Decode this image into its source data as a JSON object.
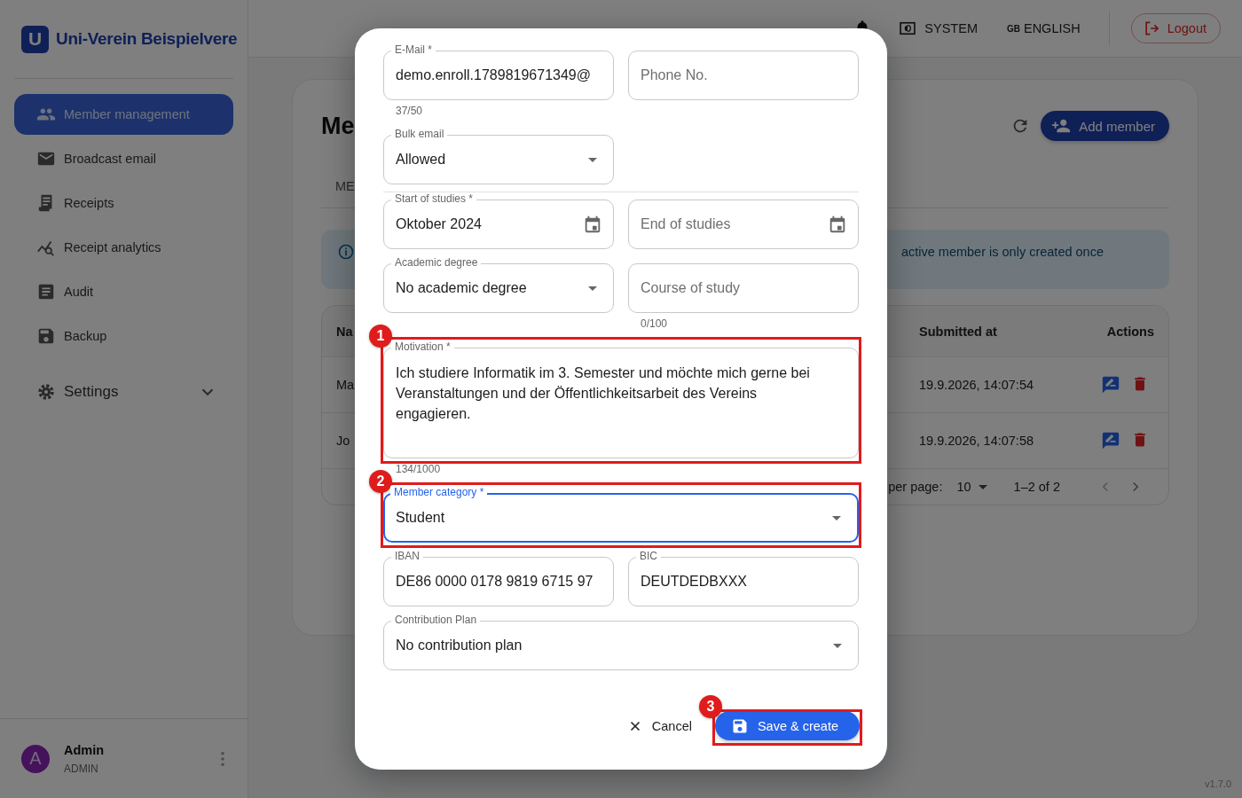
{
  "sidebar": {
    "brand": {
      "logo": "U",
      "name": "Uni-Verein Beispielvere"
    },
    "items": [
      {
        "kind": "link",
        "label": "Member management",
        "selected": true
      },
      {
        "kind": "link",
        "label": "Broadcast email",
        "selected": false
      },
      {
        "kind": "link",
        "label": "Receipts",
        "selected": false
      },
      {
        "kind": "link",
        "label": "Receipt analytics",
        "selected": false
      },
      {
        "kind": "link",
        "label": "Audit",
        "selected": false
      },
      {
        "kind": "link",
        "label": "Backup",
        "selected": false
      },
      {
        "kind": "group",
        "label": "Settings",
        "selected": false,
        "expanded": false
      }
    ],
    "user": {
      "initial": "A",
      "name": "Admin",
      "role": "ADMIN"
    }
  },
  "header": {
    "theme": "SYSTEM",
    "language_code": "GB",
    "language": "ENGLISH",
    "logout": "Logout"
  },
  "page": {
    "title": "Me",
    "add_button": "Add member",
    "tabs": [
      {
        "label": "ME"
      }
    ],
    "info": "active member is only created once",
    "table": {
      "columns": [
        "Na",
        "Submitted at",
        "Actions"
      ],
      "rows": [
        {
          "name": "Ma",
          "submitted_at": "19.9.2026, 14:07:54"
        },
        {
          "name": "Jo",
          "submitted_at": "19.9.2026, 14:07:58"
        }
      ],
      "pagination": {
        "rows_per_page_label": "per page:",
        "rows_per_page": "10",
        "range": "1–2 of 2"
      }
    }
  },
  "dialog": {
    "rows": [
      {
        "kind": "pair",
        "fields": [
          {
            "kind": "text",
            "label": "E-Mail *",
            "value": "demo.enroll.1789819671349@",
            "counter": "37/50",
            "focused": false
          },
          {
            "kind": "text",
            "placeholder": "Phone No.",
            "focused": false
          }
        ]
      },
      {
        "kind": "single",
        "fields": [
          {
            "kind": "select",
            "label": "Bulk email",
            "value": "Allowed",
            "focused": false
          }
        ]
      },
      {
        "kind": "divider"
      },
      {
        "kind": "pair",
        "fields": [
          {
            "kind": "date",
            "label": "Start of studies *",
            "value": "Oktober 2024",
            "focused": false
          },
          {
            "kind": "date",
            "placeholder": "End of studies",
            "focused": false
          }
        ]
      },
      {
        "kind": "pair",
        "fields": [
          {
            "kind": "select",
            "label": "Academic degree",
            "value": "No academic degree",
            "focused": false
          },
          {
            "kind": "text",
            "placeholder": "Course of study",
            "counter": "0/100",
            "focused": false
          }
        ]
      },
      {
        "kind": "wide",
        "fields": [
          {
            "kind": "textarea",
            "label": "Motivation *",
            "value": "Ich studiere Informatik im 3. Semester und möchte mich gerne bei Veranstaltungen und der Öffentlichkeitsarbeit des Vereins engagieren.",
            "counter": "134/1000",
            "focused": false,
            "annotation": "1"
          }
        ]
      },
      {
        "kind": "wide",
        "fields": [
          {
            "kind": "select",
            "label": "Member category *",
            "value": "Student",
            "focused": true,
            "annotation": "2"
          }
        ]
      },
      {
        "kind": "pair",
        "fields": [
          {
            "kind": "text",
            "label": "IBAN",
            "value": "DE86 0000 0178 9819 6715 97",
            "focused": false
          },
          {
            "kind": "text",
            "label": "BIC",
            "value": "DEUTDEDBXXX",
            "focused": false
          }
        ]
      },
      {
        "kind": "wide",
        "fields": [
          {
            "kind": "select",
            "label": "Contribution Plan",
            "value": "No contribution plan",
            "focused": false
          }
        ]
      }
    ],
    "cancel": "Cancel",
    "save": {
      "label": "Save & create",
      "annotation": "3"
    }
  },
  "version": "v1.7.0"
}
